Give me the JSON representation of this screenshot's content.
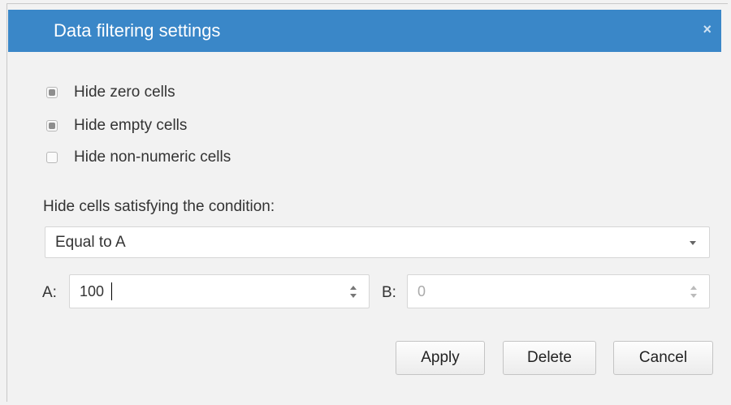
{
  "dialog": {
    "title": "Data filtering settings",
    "close_symbol": "×"
  },
  "options": [
    {
      "label": "Hide zero cells",
      "checked": true
    },
    {
      "label": "Hide empty cells",
      "checked": true
    },
    {
      "label": "Hide non-numeric cells",
      "checked": false
    }
  ],
  "condition": {
    "label": "Hide cells satisfying the condition:",
    "selected": "Equal to A"
  },
  "inputs": {
    "a_label": "A:",
    "a_value": "100",
    "b_label": "B:",
    "b_value": "0"
  },
  "buttons": {
    "apply": "Apply",
    "delete": "Delete",
    "cancel": "Cancel"
  },
  "colors": {
    "title_bar": "#3a87c8",
    "background": "#f2f2f2"
  }
}
